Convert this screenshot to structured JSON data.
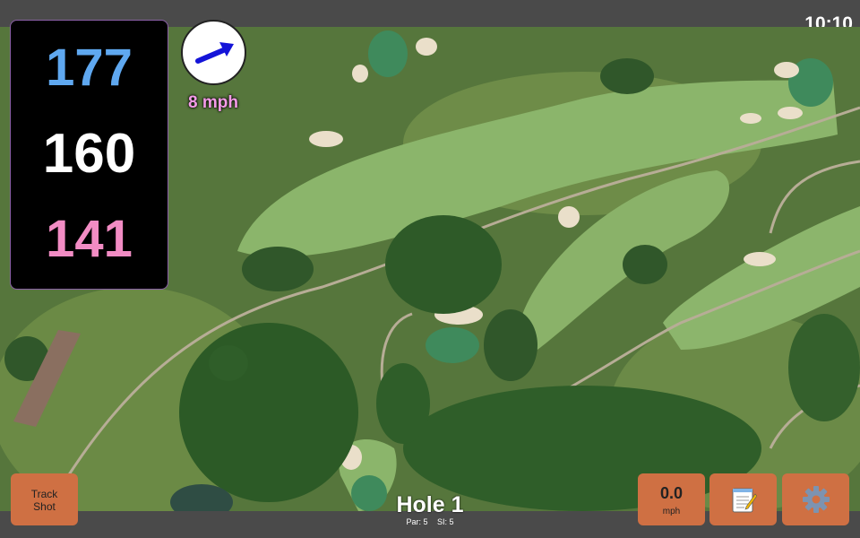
{
  "status": {
    "time": "10:10"
  },
  "distances": {
    "back": "177",
    "middle": "160",
    "front": "141"
  },
  "wind": {
    "speed_text": "8 mph"
  },
  "buttons": {
    "track_shot_line1": "Track",
    "track_shot_line2": "Shot",
    "speed_value": "0.0",
    "speed_unit": "mph",
    "notes_icon": "notepad-icon",
    "settings_icon": "gear-icon"
  },
  "hole": {
    "title": "Hole 1",
    "par": "Par: 5",
    "si": "SI: 5"
  },
  "colors": {
    "back_distance": "#5fa8f0",
    "mid_distance": "#ffffff",
    "front_distance": "#f28cc4",
    "wind_text": "#f49be8",
    "button_bg": "#cf7043",
    "bar_bg": "#4a4a4a"
  }
}
